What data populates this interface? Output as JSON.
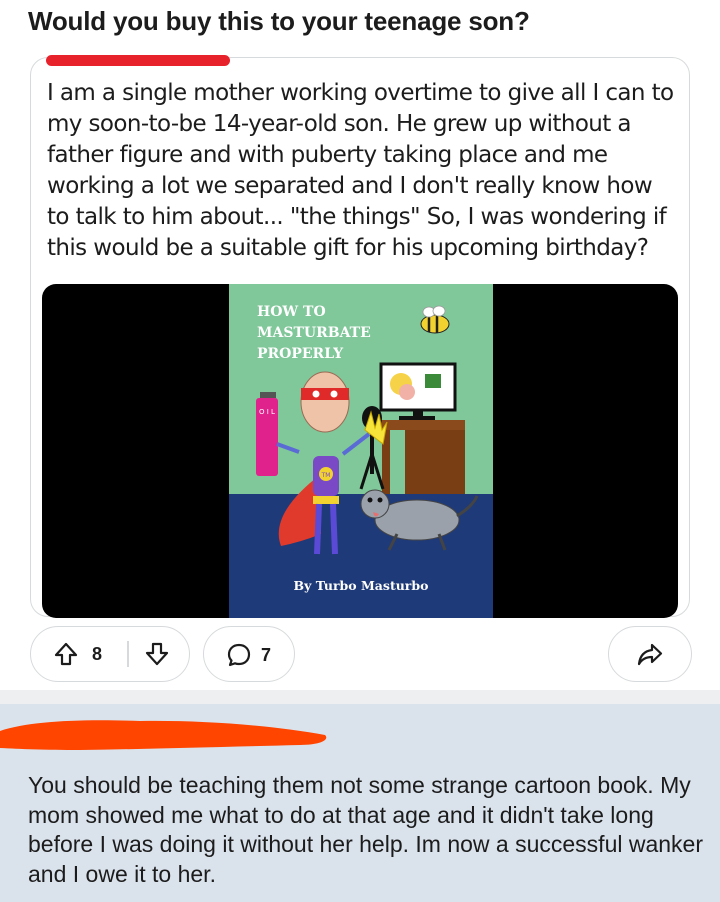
{
  "post": {
    "title": "Would you buy this to your teenage son?"
  },
  "quoted_post": {
    "body": "I am a single mother working overtime to give all I can to my soon-to-be 14-year-old son. He grew up without a father figure and with puberty taking place and me working a lot we separated and I don't really know how to talk to him about... \"the things\" So, I was wondering if this would be a suitable gift for his upcoming birthday?",
    "book_cover": {
      "title_lines": [
        "HOW TO",
        "MASTURBATE",
        "PROPERLY"
      ],
      "author": "By Turbo Masturbo",
      "bottle_label": "O I L",
      "belt_logo": "TM"
    }
  },
  "actions": {
    "upvote_count": "8",
    "comment_count": "7"
  },
  "comment": {
    "text": "You should be teaching them not some strange cartoon book. My mom showed me what to do at that age and it didn't take long before I was doing it without her help. Im now a successful wanker and I owe it to her."
  },
  "colors": {
    "redaction_red": "#e8222b",
    "redaction_orange": "#ff4500",
    "cover_green": "#80c79a",
    "cover_floor": "#1f3a78",
    "comment_bg": "#dae2ec"
  }
}
